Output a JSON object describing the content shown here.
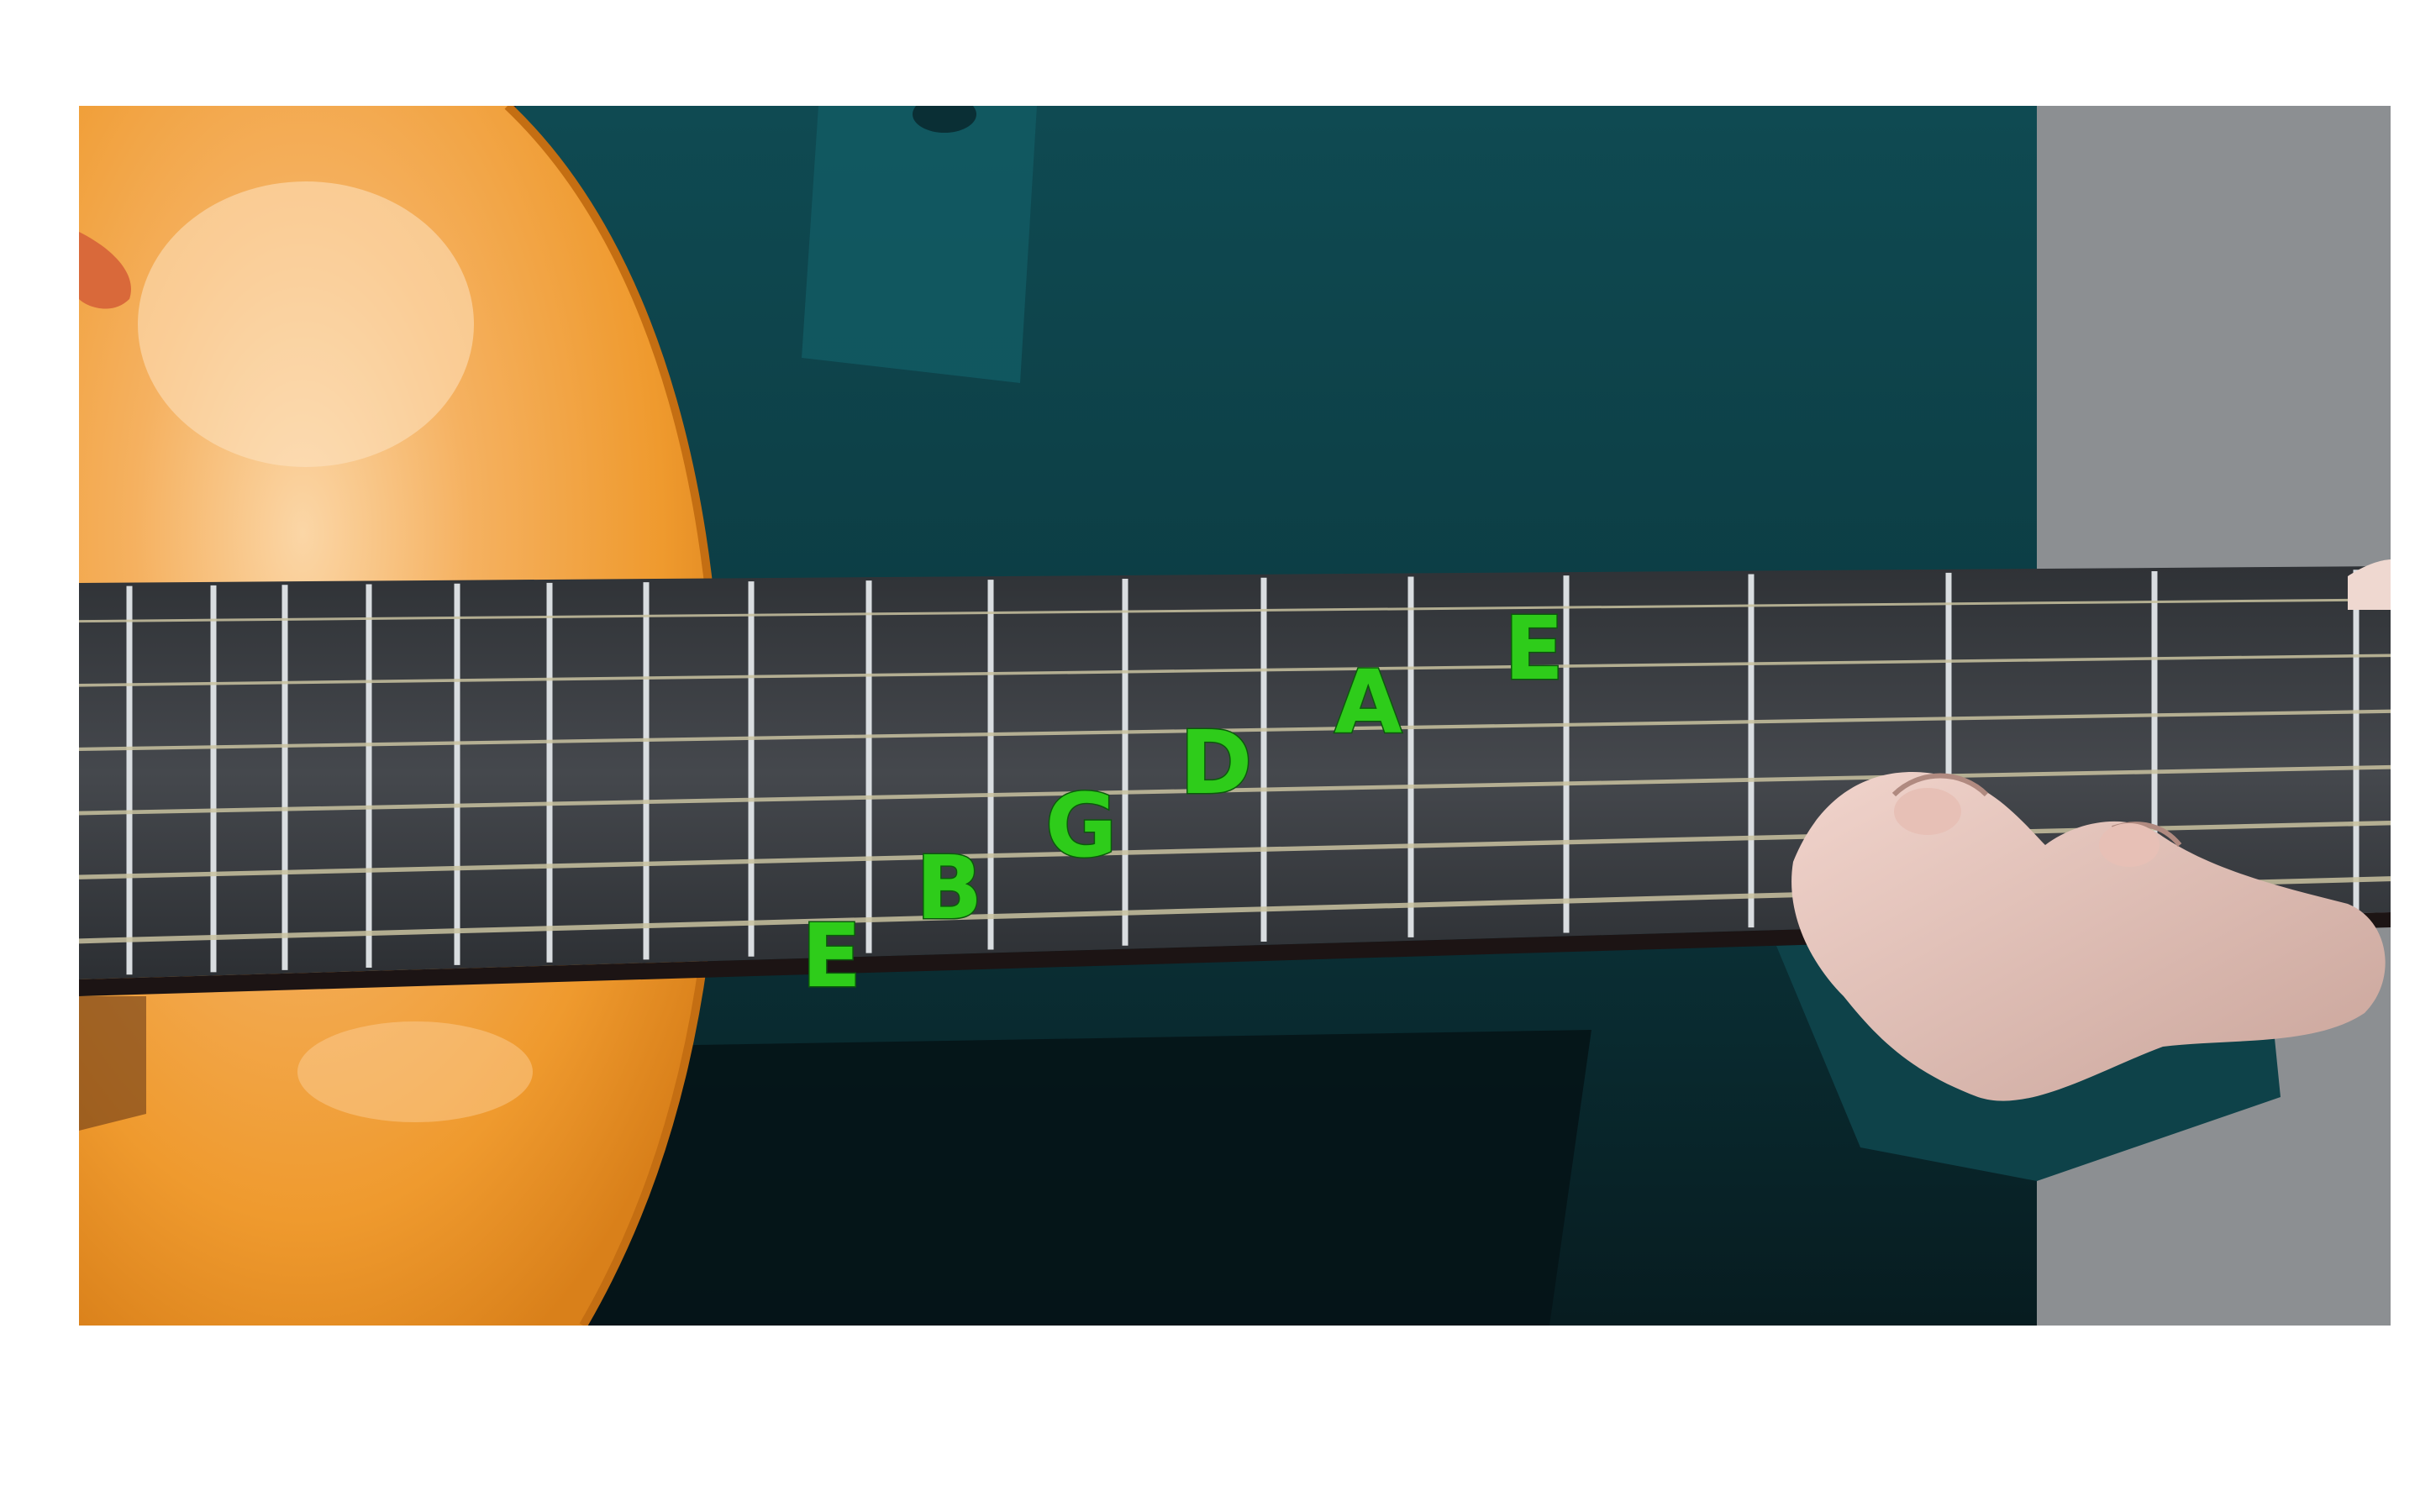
{
  "photo": {
    "subject": "guitar-fretboard-photo"
  },
  "string_labels": [
    {
      "id": "string-1",
      "text": "E"
    },
    {
      "id": "string-2",
      "text": "B"
    },
    {
      "id": "string-3",
      "text": "G"
    },
    {
      "id": "string-4",
      "text": "D"
    },
    {
      "id": "string-5",
      "text": "A"
    },
    {
      "id": "string-6",
      "text": "E"
    }
  ],
  "colors": {
    "label": "#2ecc1a",
    "guitar_body": "#f2a03c",
    "shirt": "#0d3a40",
    "fretboard": "#3c3f43",
    "frets": "#d9dde0",
    "strings": "#c9c2a0",
    "background": "#8a8d90"
  }
}
